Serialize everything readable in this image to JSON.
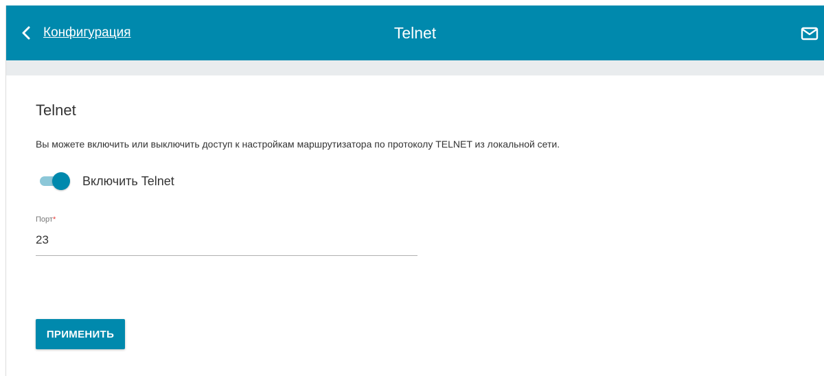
{
  "header": {
    "back_label": "Конфигурация",
    "title": "Telnet",
    "back_icon": "chevron-left-icon",
    "mail_icon": "mail-icon"
  },
  "section": {
    "title": "Telnet",
    "description": "Вы можете включить или выключить доступ к настройкам маршрутизатора по протоколу TELNET из локальной сети."
  },
  "toggle": {
    "label": "Включить Telnet",
    "enabled": true
  },
  "port_field": {
    "label": "Порт",
    "required_mark": "*",
    "value": "23"
  },
  "apply_button": {
    "label": "ПРИМЕНИТЬ"
  },
  "colors": {
    "accent": "#0089ad",
    "toggle_track": "#8cc7d8",
    "band": "#e9ecee",
    "required": "#e53935"
  }
}
